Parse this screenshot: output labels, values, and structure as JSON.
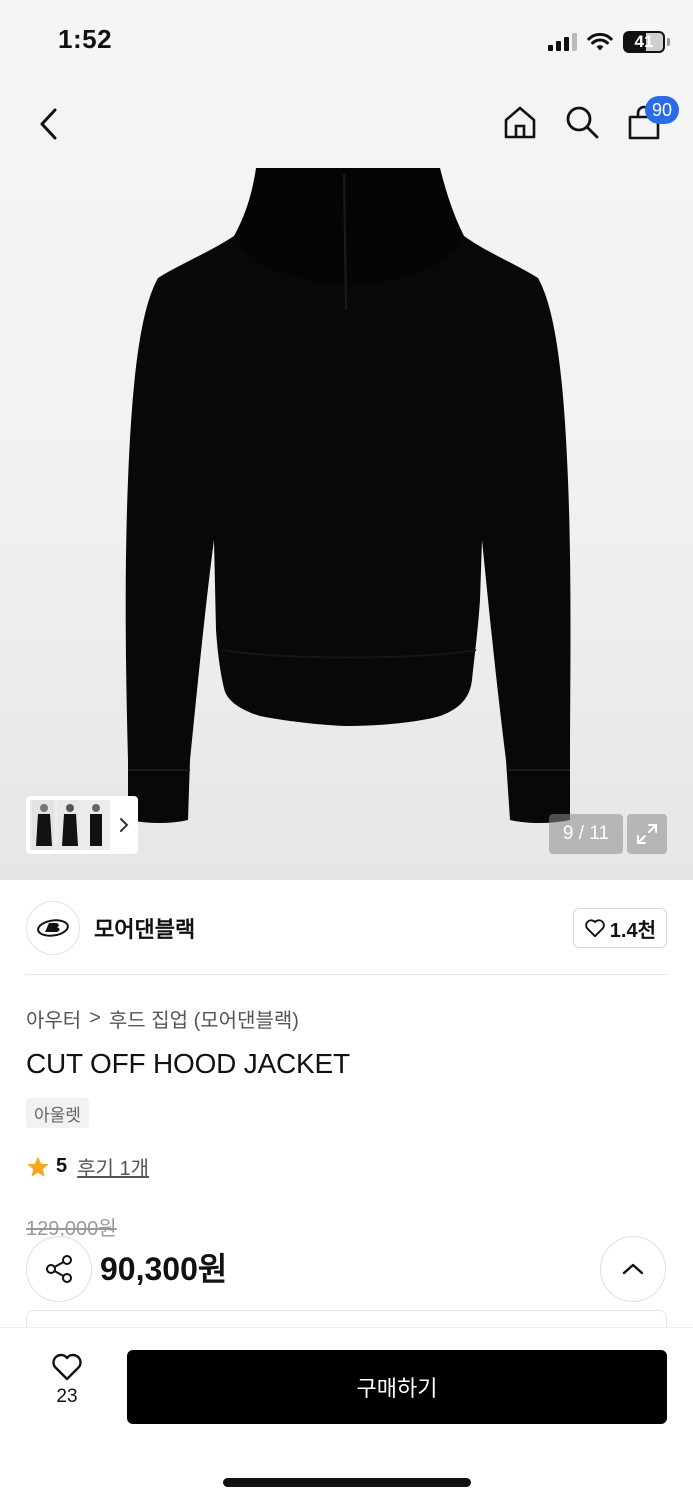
{
  "status_bar": {
    "time": "1:52",
    "battery": "41"
  },
  "header": {
    "cart_count": "90"
  },
  "gallery": {
    "counter": "9 / 11"
  },
  "brand": {
    "name": "모어댄블랙",
    "like_count": "1.4천"
  },
  "breadcrumb": {
    "category": "아우터",
    "separator": ">",
    "subcategory": "후드 집업 (모어댄블랙)"
  },
  "product": {
    "title": "CUT OFF HOOD JACKET",
    "tag": "아울렛",
    "rating": "5",
    "reviews": "후기 1개",
    "original_price": "129,000원",
    "price": "90,300원"
  },
  "bottom_bar": {
    "wish_count": "23",
    "buy_label": "구매하기"
  },
  "colors": {
    "accent": "#2b6be8",
    "star": "#f5a623",
    "primary_button": "#000000"
  }
}
